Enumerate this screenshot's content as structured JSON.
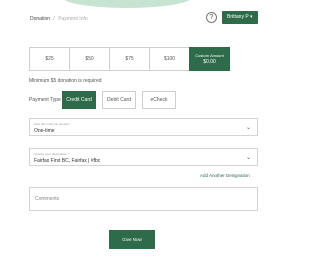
{
  "header": {
    "breadcrumb_current": "Donation",
    "breadcrumb_separator": "/",
    "breadcrumb_next": "Payment Info",
    "help_glyph": "?",
    "user_label": "Brittany P"
  },
  "amounts": {
    "options": [
      "$25",
      "$50",
      "$75",
      "$100"
    ],
    "custom_label": "Custom Amount",
    "custom_value": "$0.00"
  },
  "min_note": "Minimum $5 donation is required",
  "payment": {
    "label": "Payment Type",
    "options": [
      "Credit Card",
      "Debit Card",
      "eCheck"
    ],
    "selected": "Credit Card"
  },
  "frequency": {
    "small_label": "How often will you donate?",
    "value": "One-time"
  },
  "designation": {
    "small_label": "Choose your designation *",
    "value": "Fairfax First BC, Fairfax | #fbc"
  },
  "add_designation": "Add Another Designation",
  "comments_label": "Comments",
  "give_button": "Give Now",
  "colors": {
    "brand": "#2e6b4b",
    "arc": "#c7e3d1"
  }
}
